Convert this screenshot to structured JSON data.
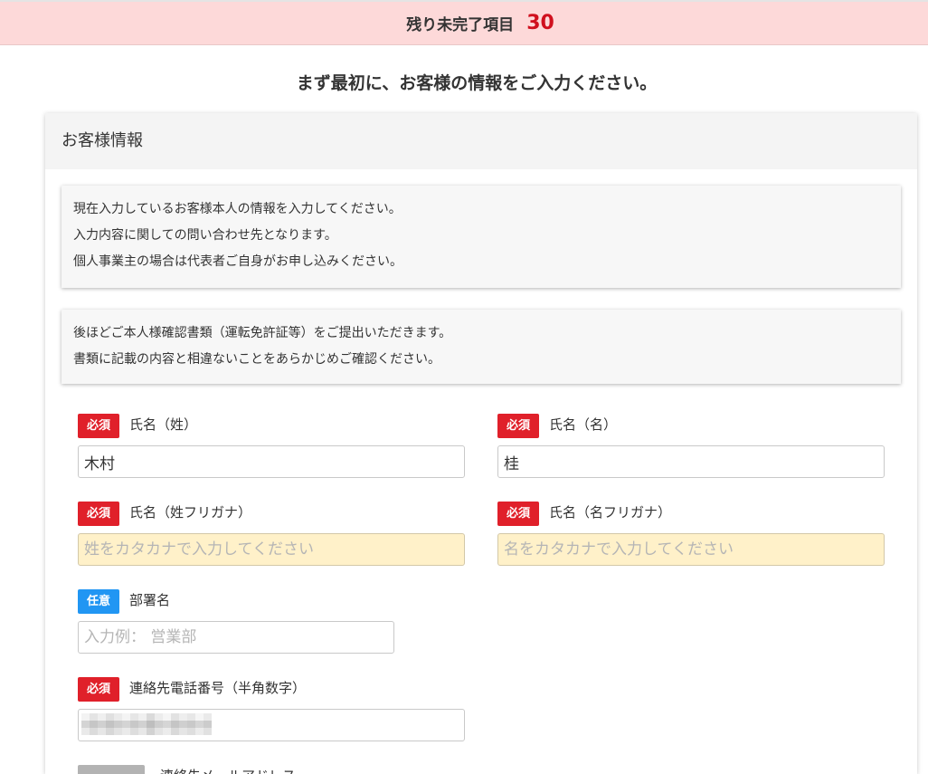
{
  "banner": {
    "label": "残り未完了項目",
    "count": "30"
  },
  "heading": "まず最初に、お客様の情報をご入力ください。",
  "card": {
    "title": "お客様情報",
    "notes": [
      {
        "lines": [
          "現在入力しているお客様本人の情報を入力してください。",
          "入力内容に関しての問い合わせ先となります。",
          "個人事業主の場合は代表者ご自身がお申し込みください。"
        ]
      },
      {
        "lines": [
          "後ほどご本人様確認書類（運転免許証等）をご提出いただきます。",
          "書類に記載の内容と相違ないことをあらかじめご確認ください。"
        ]
      }
    ]
  },
  "form": {
    "last_name": {
      "badge": "必須",
      "label": "氏名（姓）",
      "value": "木村"
    },
    "first_name": {
      "badge": "必須",
      "label": "氏名（名）",
      "value": "桂"
    },
    "last_name_kana": {
      "badge": "必須",
      "label": "氏名（姓フリガナ）",
      "placeholder": "姓をカタカナで入力してください"
    },
    "first_name_kana": {
      "badge": "必須",
      "label": "氏名（名フリガナ）",
      "placeholder": "名をカタカナで入力してください"
    },
    "department": {
      "badge": "任意",
      "label": "部署名",
      "placeholder": "入力例： 営業部"
    },
    "phone": {
      "badge": "必須",
      "label": "連絡先電話番号（半角数字）"
    },
    "email": {
      "label": "連絡先メールアドレス"
    }
  },
  "colors": {
    "banner_bg": "#fdd9d9",
    "count": "#d0101e",
    "required_badge": "#e0202a",
    "optional_badge": "#2196f3",
    "muted_badge": "#b3b3b3",
    "kana_input_bg": "#fff1c9"
  }
}
